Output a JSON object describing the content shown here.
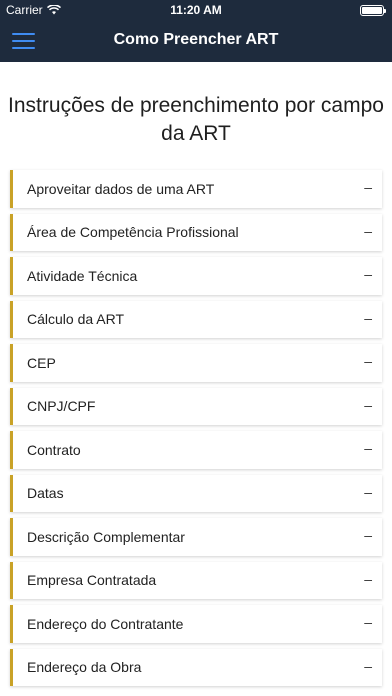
{
  "status": {
    "carrier": "Carrier",
    "time": "11:20 AM"
  },
  "nav": {
    "title": "Como Preencher ART",
    "menu_icon": "hamburger-menu-icon"
  },
  "main": {
    "heading": "Instruções de preenchimento por campo da ART",
    "toggle_symbol": "–",
    "items": [
      {
        "label": "Aproveitar dados de uma ART"
      },
      {
        "label": "Área de Competência Profissional"
      },
      {
        "label": "Atividade Técnica"
      },
      {
        "label": "Cálculo da ART"
      },
      {
        "label": "CEP"
      },
      {
        "label": "CNPJ/CPF"
      },
      {
        "label": "Contrato"
      },
      {
        "label": "Datas"
      },
      {
        "label": "Descrição Complementar"
      },
      {
        "label": "Empresa Contratada"
      },
      {
        "label": "Endereço do Contratante"
      },
      {
        "label": "Endereço da Obra"
      }
    ]
  },
  "colors": {
    "nav_background": "#1e2b3d",
    "accent_border": "#c9a227",
    "menu_icon": "#3f8cf2"
  }
}
